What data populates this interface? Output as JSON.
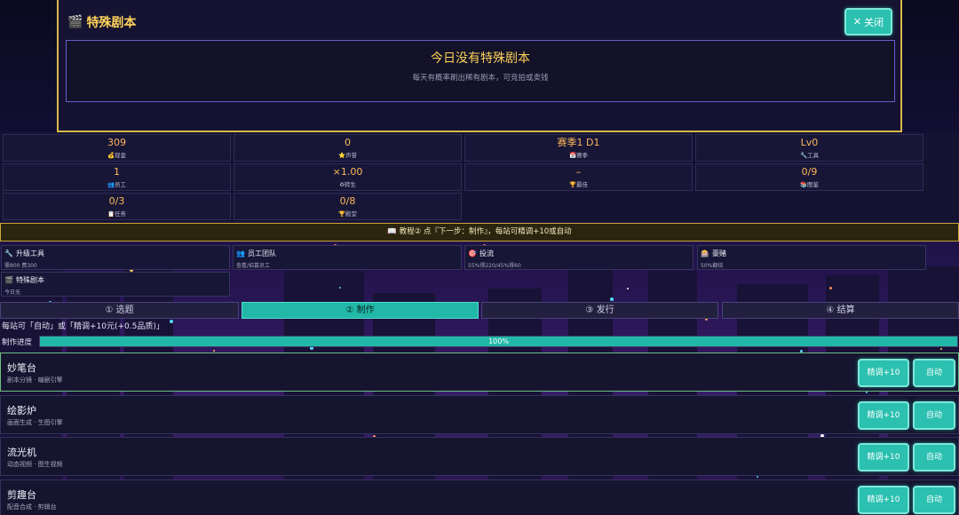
{
  "modal": {
    "icon": "🎬",
    "title": "特殊剧本",
    "close_label": "关闭",
    "empty_title": "今日没有特殊剧本",
    "empty_sub": "每天有概率刷出稀有剧本，可竞拍或卖钱"
  },
  "stats": [
    {
      "value": "309",
      "icon": "💰",
      "label": "现金"
    },
    {
      "value": "0",
      "icon": "⭐",
      "label": "声誉"
    },
    {
      "value": "赛季1 D1",
      "icon": "📅",
      "label": "赛季"
    },
    {
      "value": "Lv0",
      "icon": "🔧",
      "label": "工具"
    },
    {
      "value": "1",
      "icon": "👥",
      "label": "员工"
    },
    {
      "value": "×1.00",
      "icon": "♻",
      "label": "转生"
    },
    {
      "value": "–",
      "icon": "🏆",
      "label": "最佳"
    },
    {
      "value": "0/9",
      "icon": "📚",
      "label": "图鉴"
    },
    {
      "value": "0/3",
      "icon": "📋",
      "label": "任务"
    },
    {
      "value": "0/8",
      "icon": "🏆",
      "label": "殿堂"
    }
  ],
  "tutorial": "📖 教程② 点『下一步：制作』，每站可精调+10或自动",
  "actions": [
    {
      "icon": "🔧",
      "title": "升级工具",
      "sub": "需800 费300"
    },
    {
      "icon": "👥",
      "title": "员工团队",
      "sub": "查看/招募员工"
    },
    {
      "icon": "🎯",
      "title": "投流",
      "sub": "55%得220/45%得60"
    },
    {
      "icon": "🎰",
      "title": "豪赌",
      "sub": "50%翻倍"
    },
    {
      "icon": "🎬",
      "title": "特殊剧本",
      "sub": "今日无"
    }
  ],
  "tabs": [
    "① 选题",
    "② 制作",
    "③ 发行",
    "④ 结算"
  ],
  "active_tab": 1,
  "hint": "每站可「自动」或「精调+10元(+0.5品质)」",
  "progress": {
    "label": "制作进度",
    "value": 100,
    "text": "100%"
  },
  "stations": [
    {
      "name": "妙笔台",
      "desc": "剧本分镜 · 编剧引擎",
      "refine": "精调+10",
      "auto": "自动"
    },
    {
      "name": "绘影炉",
      "desc": "画面生成 · 生图引擎",
      "refine": "精调+10",
      "auto": "自动"
    },
    {
      "name": "流光机",
      "desc": "动态视频 · 图生视频",
      "refine": "精调+10",
      "auto": "自动"
    },
    {
      "name": "剪趣台",
      "desc": "配音合成 · 剪辑台",
      "refine": "精调+10",
      "auto": "自动"
    }
  ],
  "colors": {
    "accent": "#22b8a8",
    "gold": "#ffd35a",
    "value": "#ffb85a",
    "modal_border": "#d9b84a"
  }
}
